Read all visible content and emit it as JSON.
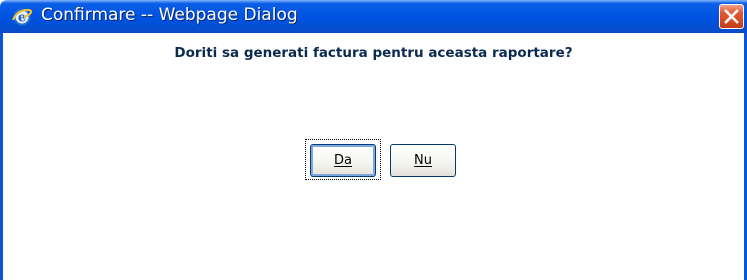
{
  "window": {
    "title": "Confirmare -- Webpage Dialog",
    "title_icon": "internet-explorer-icon",
    "close_icon": "close-icon",
    "titlebar_color": "#0054e3",
    "close_color": "#e1572f"
  },
  "dialog": {
    "question": "Doriti sa generati factura pentru aceasta raportare?",
    "question_color": "#0b2a4f"
  },
  "buttons": {
    "yes_label": "Da",
    "no_label": "Nu",
    "focused": "yes"
  }
}
